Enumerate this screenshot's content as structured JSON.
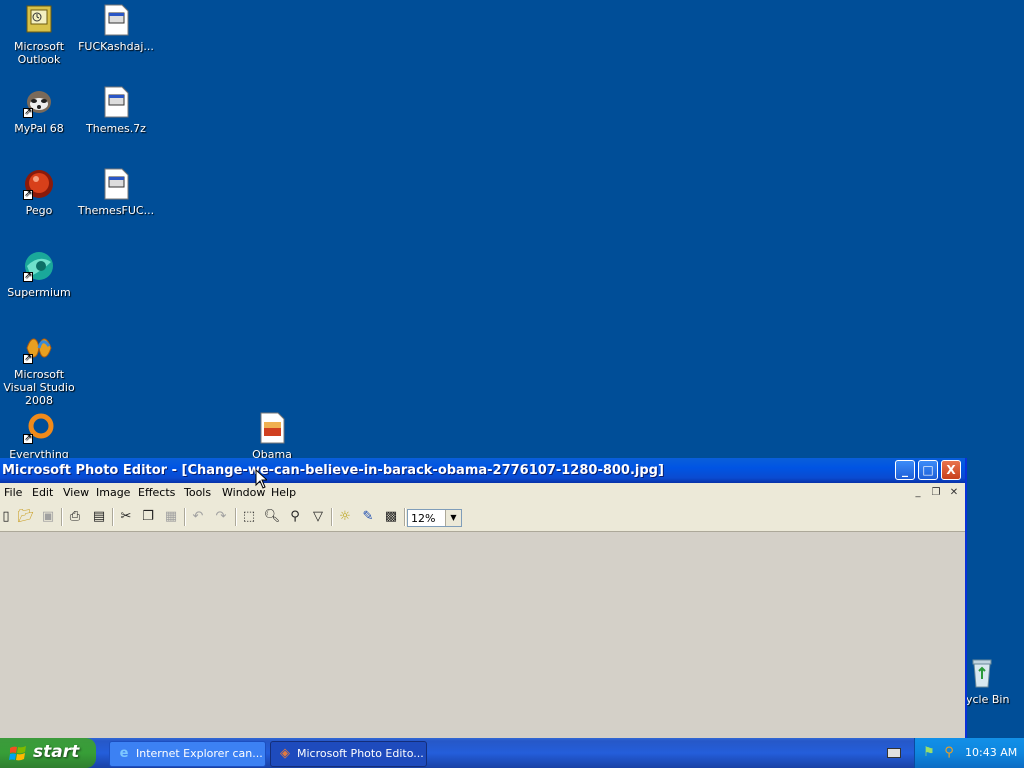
{
  "desktop": {
    "icons": [
      {
        "label": "Microsoft Outlook",
        "icon": "outlook-icon"
      },
      {
        "label": "FUCKashdaj...",
        "icon": "file-icon"
      },
      {
        "label": "MyPal 68",
        "icon": "browser-raccoon-icon"
      },
      {
        "label": "Themes.7z",
        "icon": "file-icon"
      },
      {
        "label": "Pego",
        "icon": "pego-icon"
      },
      {
        "label": "ThemesFUC...",
        "icon": "file-icon"
      },
      {
        "label": "Supermium",
        "icon": "supermium-icon"
      },
      {
        "label": "Microsoft Visual Studio 2008",
        "icon": "visual-studio-icon"
      },
      {
        "label": "Everything",
        "icon": "everything-search-icon"
      },
      {
        "label": "Obama",
        "icon": "image-file-icon"
      },
      {
        "label": "ycle Bin",
        "icon": "recycle-bin-icon"
      }
    ]
  },
  "window": {
    "title": "Microsoft Photo Editor - [Change-we-can-believe-in-barack-obama-2776107-1280-800.jpg]",
    "controls": {
      "minimize": "_",
      "maximize": "□",
      "close": "X"
    },
    "menu": [
      "File",
      "Edit",
      "View",
      "Image",
      "Effects",
      "Tools",
      "Window",
      "Help"
    ],
    "mdi_controls": {
      "minimize": "_",
      "restore": "❐",
      "close": "✕"
    },
    "toolbar": {
      "tools": [
        "new",
        "open",
        "save",
        "print",
        "scan",
        "cut",
        "copy",
        "paste",
        "undo",
        "redo",
        "select",
        "zoom",
        "smudge",
        "eyedropper",
        "balance",
        "effects",
        "properties"
      ],
      "zoom_value": "12%"
    },
    "colors": {
      "title_gradient": "#0054e3",
      "client": "#d4d0c8"
    }
  },
  "taskbar": {
    "start_label": "start",
    "tasks": [
      {
        "label": "Internet Explorer can...",
        "icon": "ie-icon",
        "active": false
      },
      {
        "label": "Microsoft Photo Edito...",
        "icon": "photo-editor-icon",
        "active": true
      }
    ],
    "clock": "10:43 AM"
  }
}
